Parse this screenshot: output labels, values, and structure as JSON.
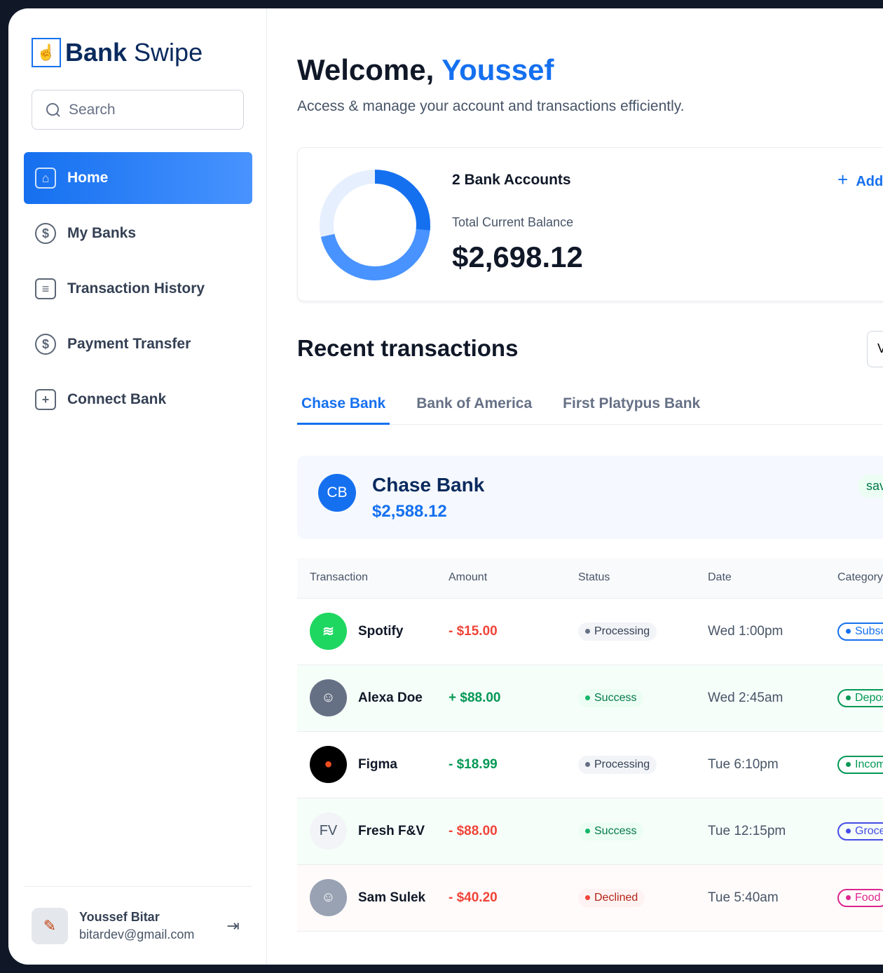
{
  "app": {
    "brand_bold": "Bank",
    "brand_light": "Swipe"
  },
  "search": {
    "placeholder": "Search"
  },
  "nav": [
    {
      "label": "Home"
    },
    {
      "label": "My Banks"
    },
    {
      "label": "Transaction History"
    },
    {
      "label": "Payment Transfer"
    },
    {
      "label": "Connect Bank"
    }
  ],
  "user": {
    "name": "Youssef Bitar",
    "email": "bitardev@gmail.com"
  },
  "header": {
    "greeting": "Welcome,",
    "name": "Youssef",
    "subtitle": "Access & manage your account and transactions efficiently."
  },
  "summary": {
    "accounts": "2 Bank Accounts",
    "balance_label": "Total Current Balance",
    "balance": "$2,698.12",
    "add_label": "Add"
  },
  "recent": {
    "title": "Recent transactions",
    "view_all": "V"
  },
  "tabs": [
    "Chase Bank",
    "Bank of America",
    "First Platypus Bank"
  ],
  "bank": {
    "initials": "CB",
    "name": "Chase Bank",
    "balance": "$2,588.12",
    "type": "sav"
  },
  "table": {
    "headers": [
      "Transaction",
      "Amount",
      "Status",
      "Date",
      "Category"
    ],
    "rows": [
      {
        "name": "Spotify",
        "amount": "- $15.00",
        "status": "Processing",
        "date": "Wed 1:00pm",
        "category": "Subscri"
      },
      {
        "name": "Alexa Doe",
        "amount": "+ $88.00",
        "status": "Success",
        "date": "Wed 2:45am",
        "category": "Deposit"
      },
      {
        "name": "Figma",
        "amount": "- $18.99",
        "status": "Processing",
        "date": "Tue 6:10pm",
        "category": "Income"
      },
      {
        "initials": "FV",
        "name": "Fresh F&V",
        "amount": "- $88.00",
        "status": "Success",
        "date": "Tue 12:15pm",
        "category": "Groceri"
      },
      {
        "name": "Sam Sulek",
        "amount": "- $40.20",
        "status": "Declined",
        "date": "Tue 5:40am",
        "category": "Food"
      }
    ]
  }
}
